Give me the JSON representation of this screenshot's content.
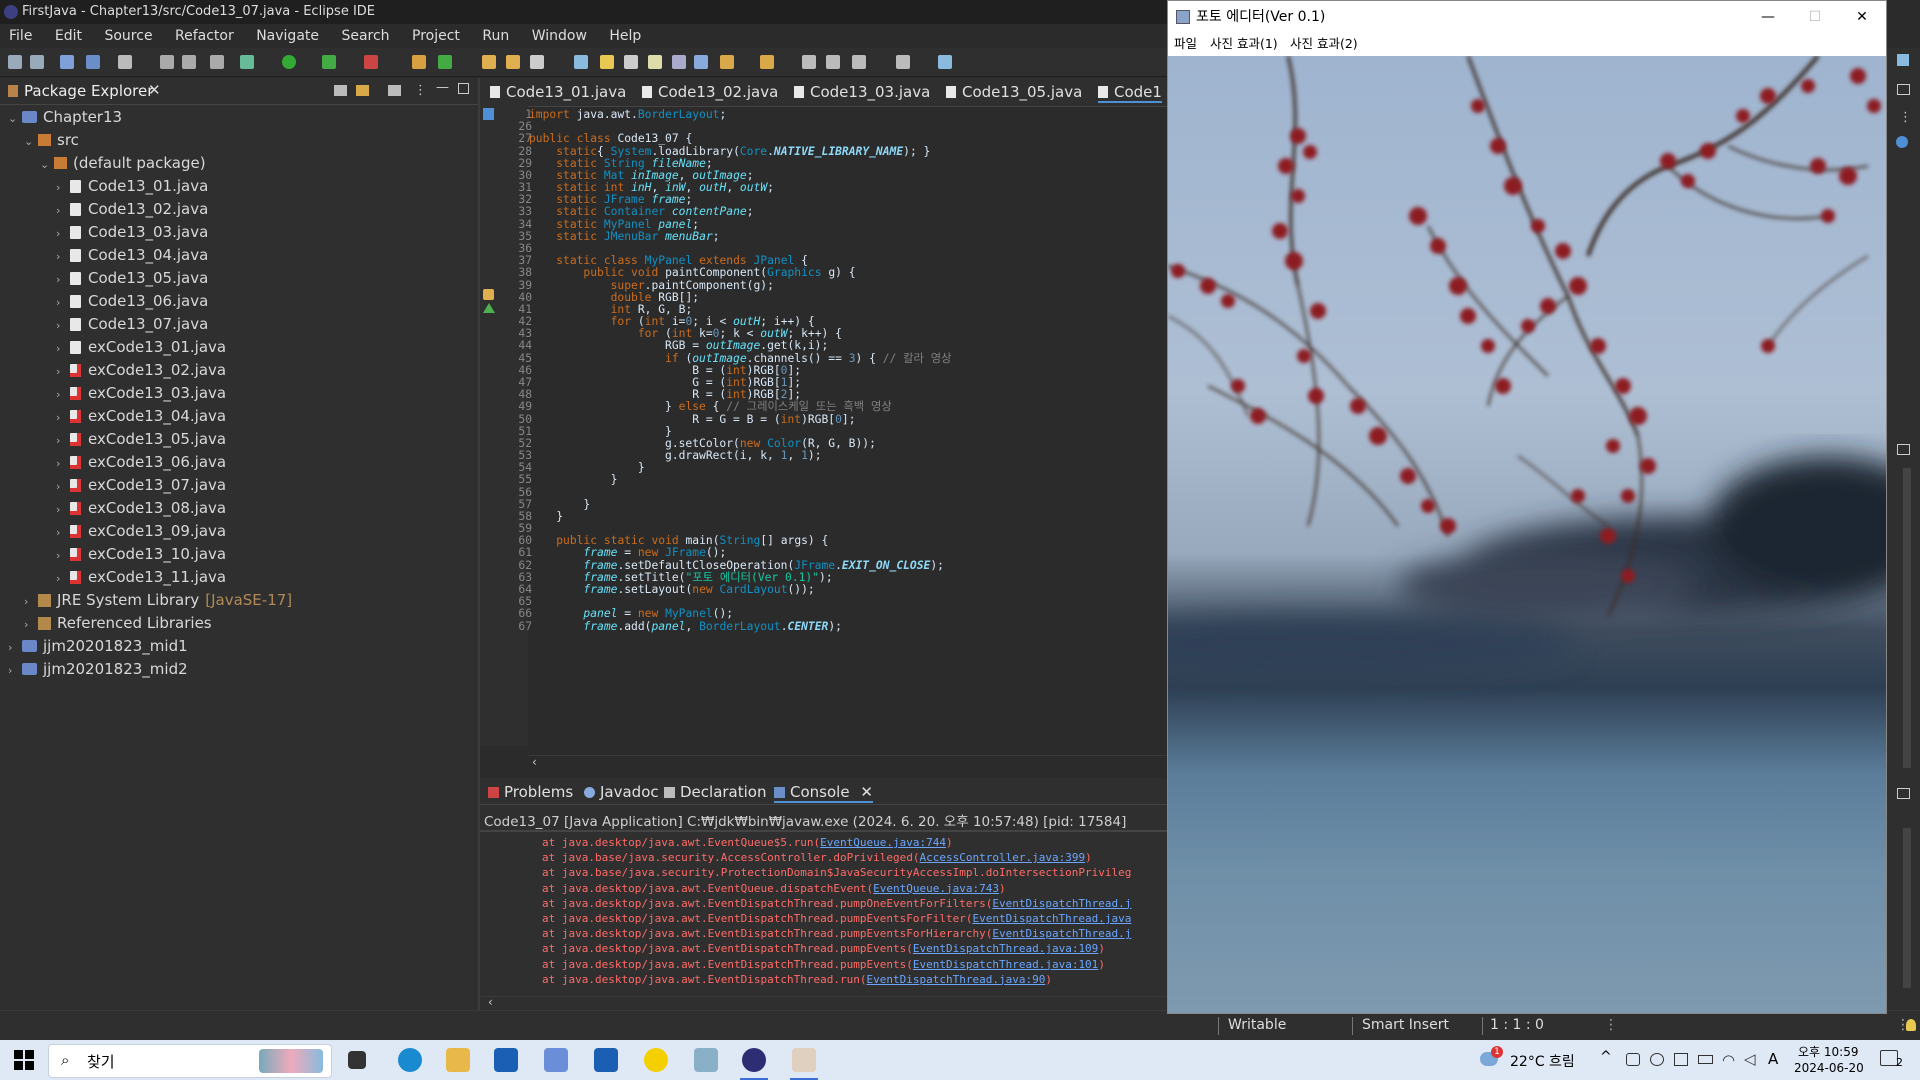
{
  "eclipse": {
    "title": "FirstJava - Chapter13/src/Code13_07.java - Eclipse IDE",
    "menu": [
      "File",
      "Edit",
      "Source",
      "Refactor",
      "Navigate",
      "Search",
      "Project",
      "Run",
      "Window",
      "Help"
    ],
    "package_explorer": {
      "tab_label": "Package Explorer",
      "close": "✕",
      "tree": [
        {
          "label": "Chapter13",
          "kind": "project",
          "indent": 0,
          "expanded": true
        },
        {
          "label": "src",
          "kind": "pkg",
          "indent": 1,
          "expanded": true
        },
        {
          "label": "(default package)",
          "kind": "pkg",
          "indent": 2,
          "expanded": true
        },
        {
          "label": "Code13_01.java",
          "kind": "file",
          "indent": 3
        },
        {
          "label": "Code13_02.java",
          "kind": "file",
          "indent": 3
        },
        {
          "label": "Code13_03.java",
          "kind": "file",
          "indent": 3
        },
        {
          "label": "Code13_04.java",
          "kind": "file",
          "indent": 3
        },
        {
          "label": "Code13_05.java",
          "kind": "file",
          "indent": 3
        },
        {
          "label": "Code13_06.java",
          "kind": "file",
          "indent": 3
        },
        {
          "label": "Code13_07.java",
          "kind": "file",
          "indent": 3
        },
        {
          "label": "exCode13_01.java",
          "kind": "file",
          "indent": 3
        },
        {
          "label": "exCode13_02.java",
          "kind": "err",
          "indent": 3
        },
        {
          "label": "exCode13_03.java",
          "kind": "err",
          "indent": 3
        },
        {
          "label": "exCode13_04.java",
          "kind": "err",
          "indent": 3
        },
        {
          "label": "exCode13_05.java",
          "kind": "err",
          "indent": 3
        },
        {
          "label": "exCode13_06.java",
          "kind": "err",
          "indent": 3
        },
        {
          "label": "exCode13_07.java",
          "kind": "err",
          "indent": 3
        },
        {
          "label": "exCode13_08.java",
          "kind": "err",
          "indent": 3
        },
        {
          "label": "exCode13_09.java",
          "kind": "err",
          "indent": 3
        },
        {
          "label": "exCode13_10.java",
          "kind": "err",
          "indent": 3
        },
        {
          "label": "exCode13_11.java",
          "kind": "err",
          "indent": 3
        },
        {
          "label": "JRE System Library",
          "extra": "[JavaSE-17]",
          "kind": "lib",
          "indent": 1
        },
        {
          "label": "Referenced Libraries",
          "kind": "lib",
          "indent": 1
        },
        {
          "label": "jjm20201823_mid1",
          "kind": "project",
          "indent": 0
        },
        {
          "label": "jjm20201823_mid2",
          "kind": "project",
          "indent": 0
        }
      ]
    },
    "editor_tabs": [
      "Code13_01.java",
      "Code13_02.java",
      "Code13_03.java",
      "Code13_05.java",
      "Code1"
    ],
    "code": [
      {
        "n": "1",
        "t": "import java.awt.BorderLayout;"
      },
      {
        "n": "26",
        "t": ""
      },
      {
        "n": "27",
        "t": "public class Code13_07 {"
      },
      {
        "n": "28",
        "t": "    static{ System.loadLibrary(Core.NATIVE_LIBRARY_NAME); }"
      },
      {
        "n": "29",
        "t": "    static String fileName;"
      },
      {
        "n": "30",
        "t": "    static Mat inImage, outImage;"
      },
      {
        "n": "31",
        "t": "    static int inH, inW, outH, outW;"
      },
      {
        "n": "32",
        "t": "    static JFrame frame;"
      },
      {
        "n": "33",
        "t": "    static Container contentPane;"
      },
      {
        "n": "34",
        "t": "    static MyPanel panel;"
      },
      {
        "n": "35",
        "t": "    static JMenuBar menuBar;"
      },
      {
        "n": "36",
        "t": ""
      },
      {
        "n": "37",
        "t": "    static class MyPanel extends JPanel {"
      },
      {
        "n": "38",
        "t": "        public void paintComponent(Graphics g) {"
      },
      {
        "n": "39",
        "t": "            super.paintComponent(g);"
      },
      {
        "n": "40",
        "t": "            double RGB[];"
      },
      {
        "n": "41",
        "t": "            int R, G, B;"
      },
      {
        "n": "42",
        "t": "            for (int i=0; i < outH; i++) {"
      },
      {
        "n": "43",
        "t": "                for (int k=0; k < outW; k++) {"
      },
      {
        "n": "44",
        "t": "                    RGB = outImage.get(k,i);"
      },
      {
        "n": "45",
        "t": "                    if (outImage.channels() == 3) { // 칼라 영상"
      },
      {
        "n": "46",
        "t": "                        B = (int)RGB[0];"
      },
      {
        "n": "47",
        "t": "                        G = (int)RGB[1];"
      },
      {
        "n": "48",
        "t": "                        R = (int)RGB[2];"
      },
      {
        "n": "49",
        "t": "                    } else { // 그레이스케일 또는 흑백 영상"
      },
      {
        "n": "50",
        "t": "                        R = G = B = (int)RGB[0];"
      },
      {
        "n": "51",
        "t": "                    }"
      },
      {
        "n": "52",
        "t": "                    g.setColor(new Color(R, G, B));"
      },
      {
        "n": "53",
        "t": "                    g.drawRect(i, k, 1, 1);"
      },
      {
        "n": "54",
        "t": "                }"
      },
      {
        "n": "55",
        "t": "            }"
      },
      {
        "n": "56",
        "t": ""
      },
      {
        "n": "57",
        "t": "        }"
      },
      {
        "n": "58",
        "t": "    }"
      },
      {
        "n": "59",
        "t": ""
      },
      {
        "n": "60",
        "t": "    public static void main(String[] args) {"
      },
      {
        "n": "61",
        "t": "        frame = new JFrame();"
      },
      {
        "n": "62",
        "t": "        frame.setDefaultCloseOperation(JFrame.EXIT_ON_CLOSE);"
      },
      {
        "n": "63",
        "t": "        frame.setTitle(\"포토 에디터(Ver 0.1)\");"
      },
      {
        "n": "64",
        "t": "        frame.setLayout(new CardLayout());"
      },
      {
        "n": "65",
        "t": ""
      },
      {
        "n": "66",
        "t": "        panel = new MyPanel();"
      },
      {
        "n": "67",
        "t": "        frame.add(panel, BorderLayout.CENTER);"
      }
    ],
    "bottom_tabs": [
      "Problems",
      "Javadoc",
      "Declaration",
      "Console"
    ],
    "console_header": "Code13_07 [Java Application] C:₩jdk₩bin₩javaw.exe  (2024. 6. 20. 오후 10:57:48) [pid: 17584]",
    "console_lines": [
      {
        "pre": "at java.desktop/java.awt.EventQueue$5.run(",
        "link": "EventQueue.java:744",
        "post": ")"
      },
      {
        "pre": "at java.base/java.security.AccessController.doPrivileged(",
        "link": "AccessController.java:399",
        "post": ")"
      },
      {
        "pre": "at java.base/java.security.ProtectionDomain$JavaSecurityAccessImpl.doIntersectionPrivileg",
        "link": "",
        "post": ""
      },
      {
        "pre": "at java.desktop/java.awt.EventQueue.dispatchEvent(",
        "link": "EventQueue.java:743",
        "post": ")"
      },
      {
        "pre": "at java.desktop/java.awt.EventDispatchThread.pumpOneEventForFilters(",
        "link": "EventDispatchThread.j",
        "post": ""
      },
      {
        "pre": "at java.desktop/java.awt.EventDispatchThread.pumpEventsForFilter(",
        "link": "EventDispatchThread.java",
        "post": ""
      },
      {
        "pre": "at java.desktop/java.awt.EventDispatchThread.pumpEventsForHierarchy(",
        "link": "EventDispatchThread.j",
        "post": ""
      },
      {
        "pre": "at java.desktop/java.awt.EventDispatchThread.pumpEvents(",
        "link": "EventDispatchThread.java:109",
        "post": ")"
      },
      {
        "pre": "at java.desktop/java.awt.EventDispatchThread.pumpEvents(",
        "link": "EventDispatchThread.java:101",
        "post": ")"
      },
      {
        "pre": "at java.desktop/java.awt.EventDispatchThread.run(",
        "link": "EventDispatchThread.java:90",
        "post": ")"
      }
    ],
    "status": {
      "writable": "Writable",
      "insert": "Smart Insert",
      "position": "1 : 1 : 0"
    }
  },
  "photo_editor": {
    "title": "포토 에디터(Ver 0.1)",
    "menu": [
      "파일",
      "사진 효과(1)",
      "사진 효과(2)"
    ],
    "controls": {
      "min": "—",
      "max": "☐",
      "close": "✕"
    }
  },
  "taskbar": {
    "search": "찾기",
    "weather": "22°C 흐림",
    "weather_badge": "1",
    "time": "오후 10:59",
    "date": "2024-06-20",
    "ime": "A",
    "notify_count": "2"
  }
}
